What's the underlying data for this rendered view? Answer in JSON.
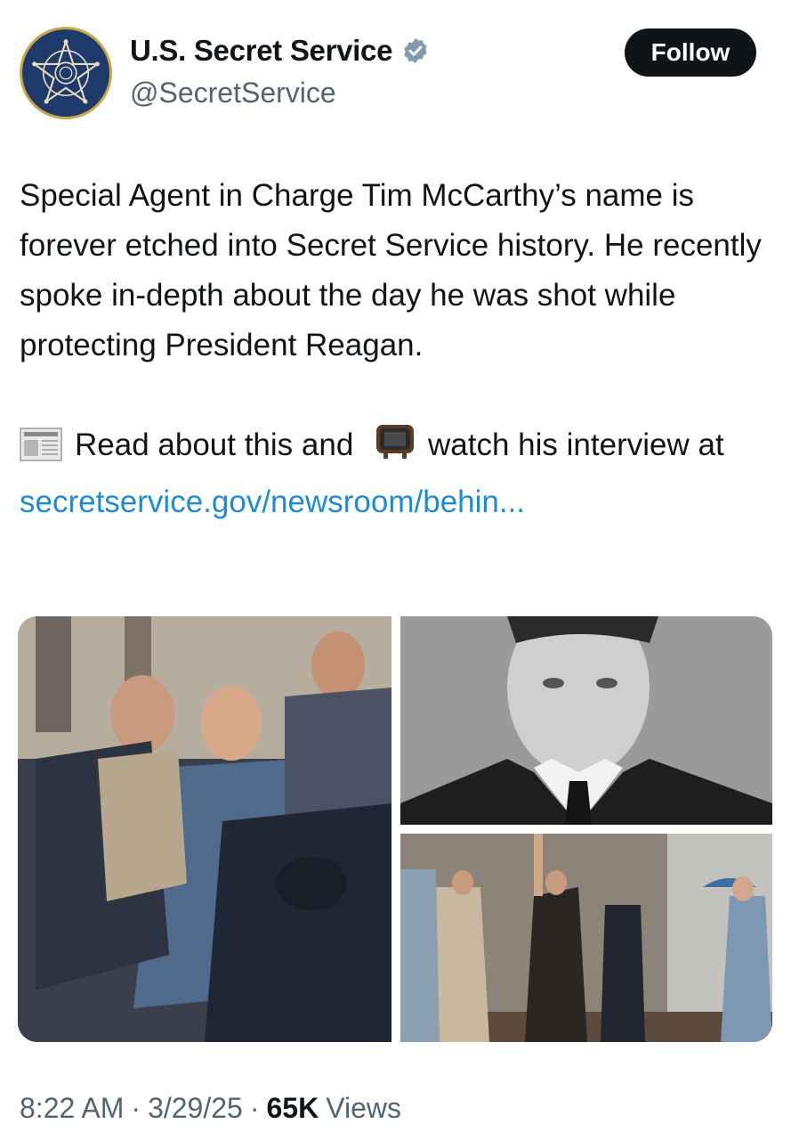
{
  "account": {
    "display_name": "U.S. Secret Service",
    "handle": "@SecretService",
    "verified": true,
    "avatar_icon": "secret-service-star-badge-icon"
  },
  "follow_label": "Follow",
  "tweet": {
    "line1": "Special Agent in Charge Tim McCarthy’s name is forever etched into Secret Service history. He recently spoke in-depth about the day he was shot while protecting President Reagan.",
    "read_text": "Read about this and",
    "watch_text": "watch his interview at",
    "link_text": "secretservice.gov/newsroom/behin...",
    "emoji_newspaper": "newspaper-icon",
    "emoji_tv": "television-icon"
  },
  "media": [
    {
      "name": "photo-assassination-attempt-crowd"
    },
    {
      "name": "photo-portrait-tim-mccarthy"
    },
    {
      "name": "photo-reagan-waving-outside-hotel"
    }
  ],
  "meta": {
    "time": "8:22 AM",
    "sep1": "·",
    "date": "3/29/25",
    "sep2": "·",
    "views_count": "65K",
    "views_label": "Views"
  },
  "colors": {
    "text": "#0f1419",
    "secondary": "#536471",
    "link": "#1d8cd4",
    "verified": "#829aab",
    "follow_bg": "#0f1419"
  }
}
